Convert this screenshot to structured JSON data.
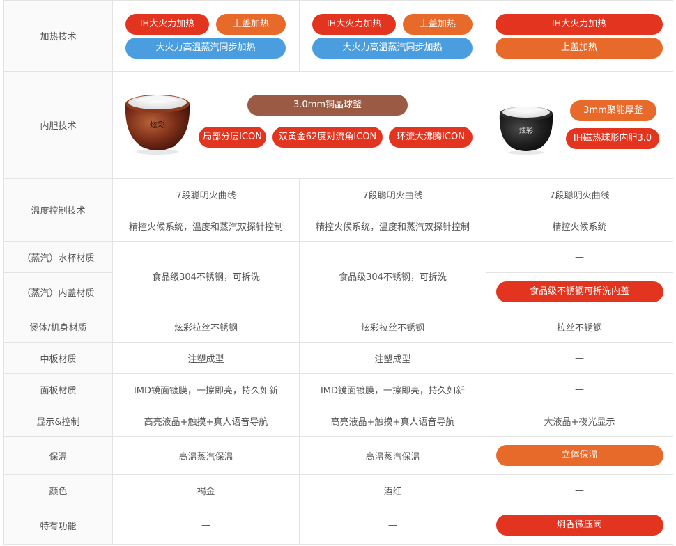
{
  "labels": {
    "heating": "加热技术",
    "liner": "内胆技术",
    "temp": "温度控制技术",
    "steam_cup": "（蒸汽）水杯材质",
    "steam_lid": "（蒸汽）内盖材质",
    "body": "煲体/机身材质",
    "mid_plate": "中板材质",
    "panel": "面板材质",
    "display": "显示&控制",
    "keep_warm": "保温",
    "color": "颜色",
    "special": "特有功能"
  },
  "heating": {
    "a": {
      "ih": "IH大火力加热",
      "lid": "上盖加热",
      "sync": "大火力高温蒸汽同步加热"
    },
    "b": {
      "ih": "IH大火力加热",
      "lid": "上盖加热",
      "sync": "大火力高温蒸汽同步加热"
    },
    "c": {
      "ih": "IH大火力加热",
      "lid": "上盖加热"
    }
  },
  "liner": {
    "ab": {
      "main": "3.0mm铜晶球釜",
      "tag1": "局部分层ICON",
      "tag2": "双黄金62度对流角ICON",
      "tag3": "环流大沸腾ICON",
      "pot_brand": "炫彩"
    },
    "c": {
      "tag1": "3mm聚能厚釜",
      "tag2": "IH磁热球形内胆3.0",
      "pot_brand": "炫彩"
    }
  },
  "temp": {
    "curve": [
      "7段聪明火曲线",
      "7段聪明火曲线",
      "7段聪明火曲线"
    ],
    "system": [
      "精控火候系统，温度和蒸汽双探针控制",
      "精控火候系统，温度和蒸汽双探针控制",
      "精控火候系统"
    ]
  },
  "steam": {
    "a": "食品级304不锈钢，可拆洗",
    "b": "食品级304不锈钢，可拆洗",
    "c_cup": "—",
    "c_lid": "食品级不锈钢可拆洗内盖"
  },
  "body": [
    "炫彩拉丝不锈钢",
    "炫彩拉丝不锈钢",
    "拉丝不锈钢"
  ],
  "mid_plate": [
    "注塑成型",
    "注塑成型",
    "—"
  ],
  "panel": [
    "IMD镜面镀膜，一擦即亮，持久如新",
    "IMD镜面镀膜，一擦即亮，持久如新",
    "—"
  ],
  "display": [
    "高亮液晶+触摸+真人语音导航",
    "高亮液晶+触摸+真人语音导航",
    "大液晶+夜光显示"
  ],
  "keep_warm": [
    "高温蒸汽保温",
    "高温蒸汽保温",
    "立体保温"
  ],
  "color": [
    "褐金",
    "酒红",
    "—"
  ],
  "special": [
    "—",
    "—",
    "焖香微压阀"
  ]
}
